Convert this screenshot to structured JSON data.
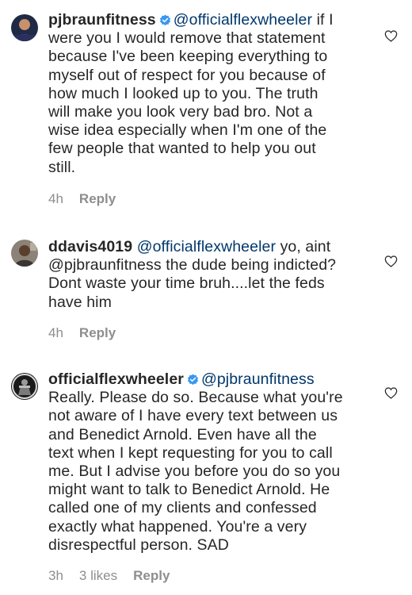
{
  "comments": [
    {
      "username": "pjbraunfitness",
      "verified": true,
      "mention": "@officialflexwheeler",
      "text_lines": [
        " if I",
        "were you I would remove that statement",
        "because I've been keeping everything to",
        "myself out of respect for you because of",
        "how much I looked up to you. The truth",
        "will make you look very bad bro. Not a",
        "wise idea especially when I'm one of the",
        "few people that wanted to help you out",
        "still."
      ],
      "time": "4h",
      "likes": "",
      "reply_label": "Reply",
      "avatar": "pjbraunfitness-avatar"
    },
    {
      "username": "ddavis4019",
      "verified": false,
      "mention": "@officialflexwheeler",
      "text_lines": [
        " yo, aint",
        "@pjbraunfitness the dude being indicted?",
        "Dont waste your time bruh....let the feds",
        "have him"
      ],
      "time": "4h",
      "likes": "",
      "reply_label": "Reply",
      "avatar": "ddavis4019-avatar"
    },
    {
      "username": "officialflexwheeler",
      "verified": true,
      "mention": "@pjbraunfitness",
      "text_lines": [
        "",
        "Really. Please do so. Because what you're",
        "not aware of I have every text  between us",
        "and Benedict Arnold. Even have all the",
        "text when I kept requesting for you to call",
        "me.  But I advise you before you do so you",
        "might want to talk to Benedict Arnold. He",
        "called one of my clients and confessed",
        "exactly what happened. You're a very",
        "disrespectful person. SAD"
      ],
      "time": "3h",
      "likes": "3 likes",
      "reply_label": "Reply",
      "avatar": "officialflexwheeler-avatar"
    }
  ],
  "colors": {
    "text": "#262626",
    "mention": "#00376b",
    "meta": "#8e8e8e",
    "verified": "#3897f0"
  },
  "icons": {
    "like": "heart-outline-icon",
    "verified": "verified-badge-icon"
  }
}
